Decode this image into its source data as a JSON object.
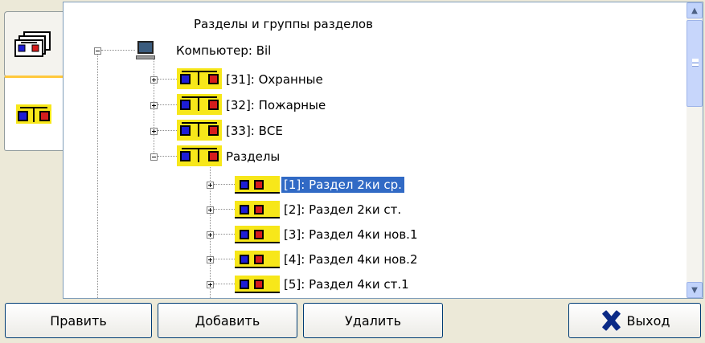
{
  "tree": {
    "header": "Разделы и группы разделов",
    "computer": "Компьютер: Bil",
    "groups": [
      "[31]: Охранные",
      "[32]: Пожарные",
      "[33]: ВСЕ"
    ],
    "sections_folder": "Разделы",
    "sections": [
      "[1]: Раздел 2ки ср.",
      "[2]: Раздел 2ки ст.",
      "[3]: Раздел 4ки нов.1",
      "[4]: Раздел 4ки нов.2",
      "[5]: Раздел 4ки ст.1"
    ],
    "selected_section": "[1]: Раздел 2ки ср."
  },
  "buttons": {
    "edit": "Править",
    "add": "Добавить",
    "delete": "Удалить",
    "exit": "Выход"
  },
  "colors": {
    "selection": "#316ac5",
    "icon_yellow": "#f7e71a",
    "accent_tab": "#ffc83c"
  },
  "icons": [
    "section-tree-icon",
    "section-group-icon",
    "computer-icon",
    "section-icon",
    "exit-x-icon"
  ]
}
